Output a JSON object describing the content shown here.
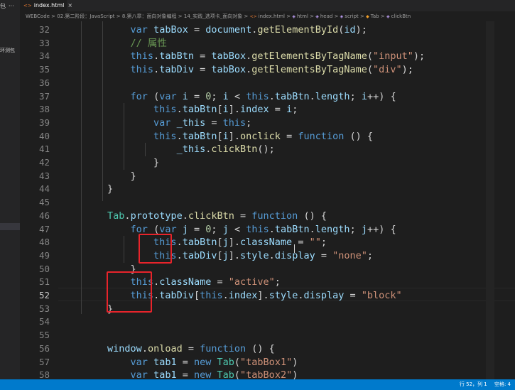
{
  "sidebar": {
    "top_text": "包",
    "more_icon": "ellipsis-icon",
    "label": "环测包"
  },
  "tab": {
    "file_name": "index.html",
    "icon": "html-file-icon",
    "close": "×"
  },
  "breadcrumbs": [
    "WEBCode",
    "02.第二阶段：JavaScript",
    "8.第八章：面向对象编程",
    "14_实践_选项卡_面向对象",
    "index.html",
    "html",
    "head",
    "script",
    "Tab",
    "clickBtn"
  ],
  "editor": {
    "line_numbers": [
      "32",
      "33",
      "34",
      "35",
      "36",
      "37",
      "38",
      "39",
      "40",
      "41",
      "42",
      "43",
      "44",
      "45",
      "46",
      "47",
      "48",
      "49",
      "50",
      "51",
      "52",
      "53",
      "54",
      "55",
      "56",
      "57",
      "58"
    ],
    "active_line": "52"
  },
  "status": {
    "position": "行 52，列 1",
    "indent": "空格: 4"
  },
  "colors": {
    "background": "#1e1e1e",
    "statusbar": "#007acc",
    "highlight": "#e8242b",
    "keyword": "#569cd6",
    "string": "#ce9178",
    "function": "#dcdcaa"
  }
}
